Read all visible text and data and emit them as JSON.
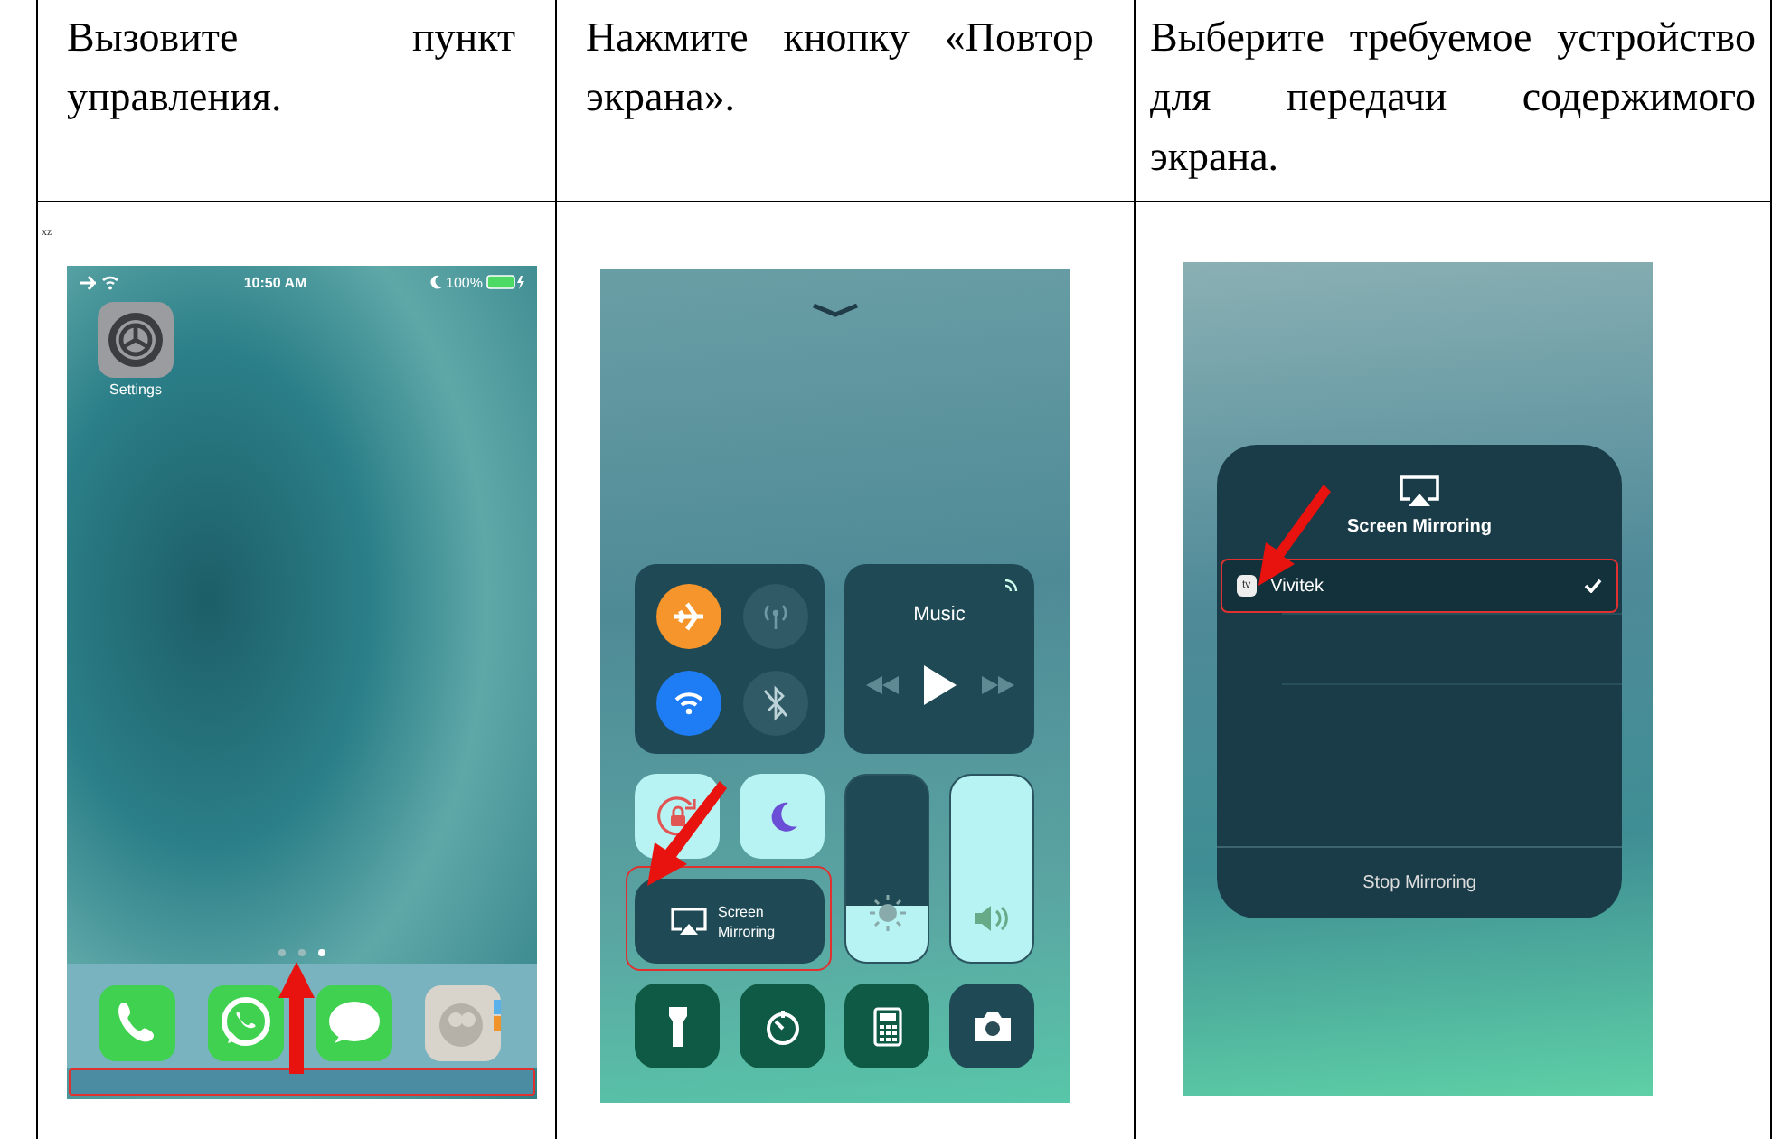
{
  "steps": [
    {
      "instruction": "Вызовите пункт управления.",
      "screen": {
        "kind": "home",
        "caption": "xz",
        "time": "10:50 AM",
        "battery": "100%",
        "app": "Settings",
        "page_dots": [
          {
            "selected": false
          },
          {
            "selected": false
          },
          {
            "selected": true
          }
        ]
      }
    },
    {
      "instruction": "Нажмите кнопку «Повтор экрана».",
      "screen": {
        "kind": "control_center",
        "music": "Music",
        "toggles": [
          {
            "kind": "airplane",
            "on": true
          },
          {
            "kind": "cellular",
            "on": false
          },
          {
            "kind": "wifi",
            "on": true
          },
          {
            "kind": "bluetooth",
            "on": false
          }
        ],
        "mirroring": "Screen Mirroring",
        "brightness": {
          "level": 0.3
        },
        "volume": {
          "level": 1
        }
      }
    },
    {
      "instruction": "Выберите требуемое устройство для передачи содержимого экрана.",
      "screen": {
        "kind": "mirroring",
        "title": "Screen Mirroring",
        "devices": [
          {
            "name": "Vivitek",
            "badge": "tv",
            "selected": true
          }
        ],
        "stop": "Stop Mirroring"
      }
    }
  ]
}
